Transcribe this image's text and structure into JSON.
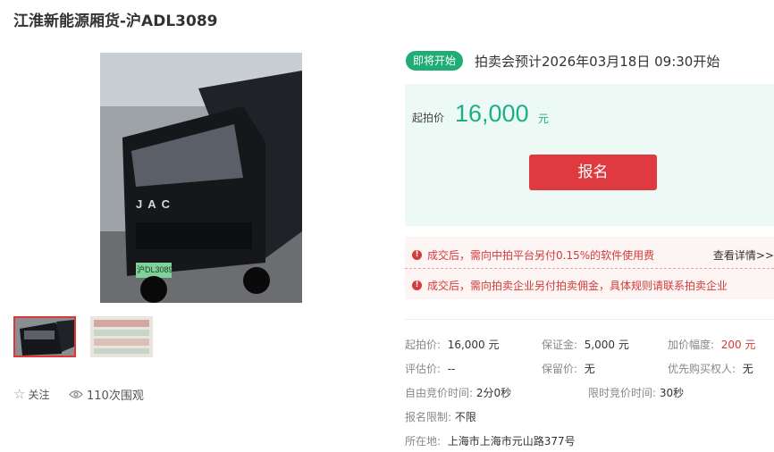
{
  "page": {
    "title": "江淮新能源厢货-沪ADL3089"
  },
  "photo": {
    "plate": "沪DL3089",
    "brand": "JAC"
  },
  "actions": {
    "follow_label": "关注",
    "views_label": "110次围观"
  },
  "auction": {
    "status": "即将开始",
    "time_text": "拍卖会预计2026年03月18日  09:30开始",
    "start_price_label": "起拍价",
    "start_price_value": "16,000",
    "start_price_unit": "元",
    "signup_label": "报名"
  },
  "notices": {
    "row1": "成交后，需向中拍平台另付0.15%的软件使用费",
    "row2": "成交后，需向拍卖企业另付拍卖佣金，具体规则请联系拍卖企业",
    "detail_link": "查看详情>>"
  },
  "details": {
    "start_price": {
      "label": "起拍价:",
      "value": "16,000 元"
    },
    "deposit": {
      "label": "保证金:",
      "value": "5,000 元"
    },
    "increment": {
      "label": "加价幅度:",
      "value": "200 元"
    },
    "appraisal": {
      "label": "评估价:",
      "value": "--"
    },
    "reserve": {
      "label": "保留价:",
      "value": "无"
    },
    "priority": {
      "label": "优先购买权人:",
      "value": "无"
    },
    "free_time": {
      "label": "自由竞价时间:",
      "value": "2分0秒"
    },
    "limit_time": {
      "label": "限时竞价时间:",
      "value": "30秒"
    },
    "signup_limit": {
      "label": "报名限制:",
      "value": "不限"
    },
    "location": {
      "label": "所在地:",
      "value": "上海市上海市元山路377号"
    }
  },
  "colors": {
    "accent_green": "#1fad86",
    "accent_red": "#de3a3f"
  }
}
